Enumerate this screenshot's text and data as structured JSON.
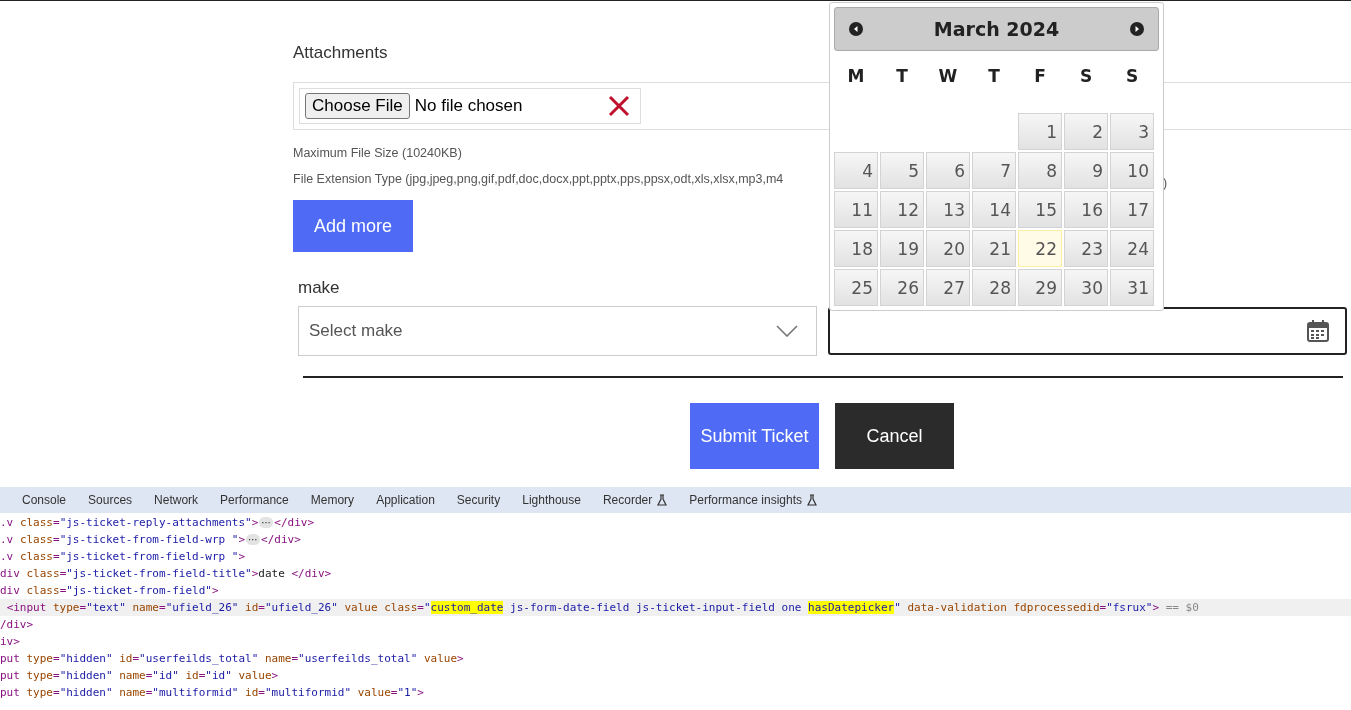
{
  "form": {
    "attachments_label": "Attachments",
    "file_input": {
      "button": "Choose File",
      "status": "No file chosen"
    },
    "max_size_text": "Maximum File Size (10240KB)",
    "extension_text": "File Extension Type (jpg,jpeg,png,gif,pdf,doc,docx,ppt,pptx,pps,ppsx,odt,xls,xlsx,mp3,m4",
    "extension_tail": ")",
    "add_more_button": "Add more",
    "make_label": "make",
    "make_select": {
      "placeholder": "Select make"
    },
    "submit_button": "Submit Ticket",
    "cancel_button": "Cancel"
  },
  "datepicker": {
    "title": "March 2024",
    "weekdays": [
      "M",
      "T",
      "W",
      "T",
      "F",
      "S",
      "S"
    ],
    "cells": [
      {
        "kind": "empty"
      },
      {
        "kind": "empty"
      },
      {
        "kind": "empty"
      },
      {
        "kind": "empty"
      },
      {
        "kind": "day",
        "label": "1",
        "today": false
      },
      {
        "kind": "day",
        "label": "2",
        "today": false
      },
      {
        "kind": "day",
        "label": "3",
        "today": false
      },
      {
        "kind": "day",
        "label": "4",
        "today": false
      },
      {
        "kind": "day",
        "label": "5",
        "today": false
      },
      {
        "kind": "day",
        "label": "6",
        "today": false
      },
      {
        "kind": "day",
        "label": "7",
        "today": false
      },
      {
        "kind": "day",
        "label": "8",
        "today": false
      },
      {
        "kind": "day",
        "label": "9",
        "today": false
      },
      {
        "kind": "day",
        "label": "10",
        "today": false
      },
      {
        "kind": "day",
        "label": "11",
        "today": false
      },
      {
        "kind": "day",
        "label": "12",
        "today": false
      },
      {
        "kind": "day",
        "label": "13",
        "today": false
      },
      {
        "kind": "day",
        "label": "14",
        "today": false
      },
      {
        "kind": "day",
        "label": "15",
        "today": false
      },
      {
        "kind": "day",
        "label": "16",
        "today": false
      },
      {
        "kind": "day",
        "label": "17",
        "today": false
      },
      {
        "kind": "day",
        "label": "18",
        "today": false
      },
      {
        "kind": "day",
        "label": "19",
        "today": false
      },
      {
        "kind": "day",
        "label": "20",
        "today": false
      },
      {
        "kind": "day",
        "label": "21",
        "today": false
      },
      {
        "kind": "day",
        "label": "22",
        "today": true
      },
      {
        "kind": "day",
        "label": "23",
        "today": false
      },
      {
        "kind": "day",
        "label": "24",
        "today": false
      },
      {
        "kind": "day",
        "label": "25",
        "today": false
      },
      {
        "kind": "day",
        "label": "26",
        "today": false
      },
      {
        "kind": "day",
        "label": "27",
        "today": false
      },
      {
        "kind": "day",
        "label": "28",
        "today": false
      },
      {
        "kind": "day",
        "label": "29",
        "today": false
      },
      {
        "kind": "day",
        "label": "30",
        "today": false
      },
      {
        "kind": "day",
        "label": "31",
        "today": false
      }
    ]
  },
  "devtools": {
    "tabs": [
      {
        "label": "Console",
        "experimental": false
      },
      {
        "label": "Sources",
        "experimental": false
      },
      {
        "label": "Network",
        "experimental": false
      },
      {
        "label": "Performance",
        "experimental": false
      },
      {
        "label": "Memory",
        "experimental": false
      },
      {
        "label": "Application",
        "experimental": false
      },
      {
        "label": "Security",
        "experimental": false
      },
      {
        "label": "Lighthouse",
        "experimental": false
      },
      {
        "label": "Recorder",
        "experimental": true
      },
      {
        "label": "Performance insights",
        "experimental": true
      }
    ],
    "code_lines": [
      {
        "selected": false,
        "segments": [
          {
            "text": ".v class=\"js-ticket-reply-attachments\">⋯</div>",
            "highlighted": false
          }
        ]
      },
      {
        "selected": false,
        "segments": [
          {
            "text": ".v class=\"js-ticket-from-field-wrp \">⋯</div>",
            "highlighted": false
          }
        ]
      },
      {
        "selected": false,
        "segments": [
          {
            "text": ".v class=\"js-ticket-from-field-wrp \">",
            "highlighted": false
          }
        ]
      },
      {
        "selected": false,
        "segments": [
          {
            "text": "div class=\"js-ticket-from-field-title\">date </div>",
            "highlighted": false
          }
        ]
      },
      {
        "selected": false,
        "segments": [
          {
            "text": "div class=\"js-ticket-from-field\">",
            "highlighted": false
          }
        ]
      },
      {
        "selected": true,
        "segments": [
          {
            "text": " <input type=\"text\" name=\"ufield_26\" id=\"ufield_26\" value class=\"",
            "highlighted": false
          },
          {
            "text": "custom_date",
            "highlighted": true
          },
          {
            "text": " js-form-date-field js-ticket-input-field one ",
            "highlighted": false
          },
          {
            "text": "hasDatepicker",
            "highlighted": true
          },
          {
            "text": "\" data-validation fdprocessedid=\"fsrux\"> == $0",
            "highlighted": false
          }
        ]
      },
      {
        "selected": false,
        "segments": [
          {
            "text": "/div>",
            "highlighted": false
          }
        ]
      },
      {
        "selected": false,
        "segments": [
          {
            "text": "iv>",
            "highlighted": false
          }
        ]
      },
      {
        "selected": false,
        "segments": [
          {
            "text": "put type=\"hidden\" id=\"userfeilds_total\" name=\"userfeilds_total\" value>",
            "highlighted": false
          }
        ]
      },
      {
        "selected": false,
        "segments": [
          {
            "text": "put type=\"hidden\" name=\"id\" id=\"id\" value>",
            "highlighted": false
          }
        ]
      },
      {
        "selected": false,
        "segments": [
          {
            "text": "put type=\"hidden\" name=\"multiformid\" id=\"multiformid\" value=\"1\">",
            "highlighted": false
          }
        ]
      }
    ]
  }
}
